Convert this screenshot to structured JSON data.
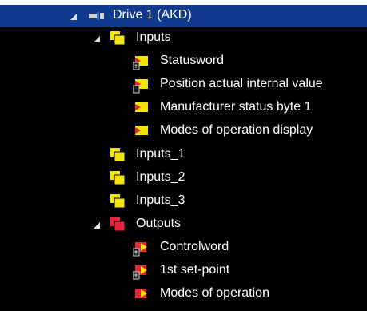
{
  "root": {
    "label": "Drive 1 (AKD)",
    "icon": "drive-icon"
  },
  "inputs": {
    "label": "Inputs",
    "icon": "input-folder-icon",
    "items": [
      {
        "label": "Statusword",
        "icon": "input-var-linked-icon"
      },
      {
        "label": "Position actual internal value",
        "icon": "input-var-icon"
      },
      {
        "label": "Manufacturer status byte 1",
        "icon": "input-var-icon"
      },
      {
        "label": "Modes of operation display",
        "icon": "input-var-icon"
      }
    ]
  },
  "groups": [
    {
      "label": "Inputs_1",
      "icon": "input-folder-icon"
    },
    {
      "label": "Inputs_2",
      "icon": "input-folder-icon"
    },
    {
      "label": "Inputs_3",
      "icon": "input-folder-icon"
    }
  ],
  "outputs": {
    "label": "Outputs",
    "icon": "output-folder-icon",
    "items": [
      {
        "label": "Controlword",
        "icon": "output-var-linked-icon"
      },
      {
        "label": "1st set-point",
        "icon": "output-var-linked-icon"
      },
      {
        "label": "Modes of operation",
        "icon": "output-var-icon"
      }
    ]
  },
  "colors": {
    "background": "#000000",
    "selection": "#0f3a8e",
    "input_yellow": "#f2e600",
    "output_red": "#e8243c",
    "text": "#ffffff"
  }
}
